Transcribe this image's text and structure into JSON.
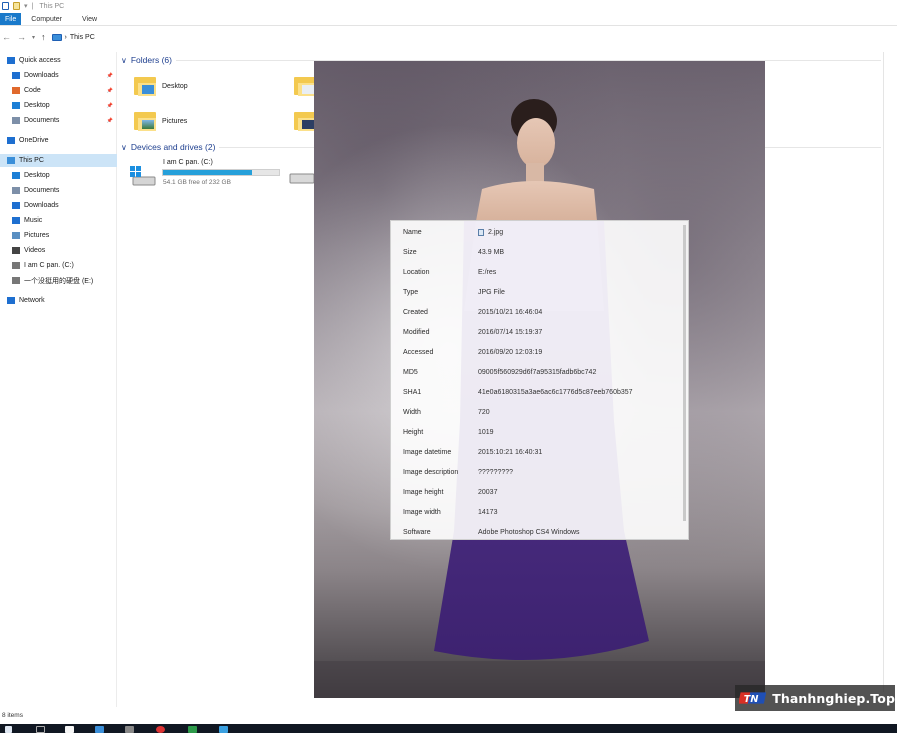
{
  "window": {
    "title": "This PC"
  },
  "ribbon": {
    "tabs": [
      "File",
      "Computer",
      "View"
    ]
  },
  "address": {
    "path": "This PC"
  },
  "sidebar": {
    "items": [
      {
        "label": "Quick access",
        "icon": "star-icon",
        "pinned": false,
        "indent": 0,
        "selected": false
      },
      {
        "label": "Downloads",
        "icon": "download-icon",
        "pinned": true,
        "indent": 1,
        "selected": false
      },
      {
        "label": "Code",
        "icon": "code-folder-icon",
        "pinned": true,
        "indent": 1,
        "selected": false
      },
      {
        "label": "Desktop",
        "icon": "desktop-icon",
        "pinned": true,
        "indent": 1,
        "selected": false
      },
      {
        "label": "Documents",
        "icon": "documents-icon",
        "pinned": true,
        "indent": 1,
        "selected": false
      },
      {
        "label": "OneDrive",
        "icon": "cloud-icon",
        "pinned": false,
        "indent": 0,
        "selected": false
      },
      {
        "label": "This PC",
        "icon": "pc-icon",
        "pinned": false,
        "indent": 0,
        "selected": true
      },
      {
        "label": "Desktop",
        "icon": "desktop-icon",
        "pinned": false,
        "indent": 1,
        "selected": false
      },
      {
        "label": "Documents",
        "icon": "documents-icon",
        "pinned": false,
        "indent": 1,
        "selected": false
      },
      {
        "label": "Downloads",
        "icon": "download-icon",
        "pinned": false,
        "indent": 1,
        "selected": false
      },
      {
        "label": "Music",
        "icon": "music-icon",
        "pinned": false,
        "indent": 1,
        "selected": false
      },
      {
        "label": "Pictures",
        "icon": "pictures-icon",
        "pinned": false,
        "indent": 1,
        "selected": false
      },
      {
        "label": "Videos",
        "icon": "videos-icon",
        "pinned": false,
        "indent": 1,
        "selected": false
      },
      {
        "label": "I am C pan. (C:)",
        "icon": "drive-icon",
        "pinned": false,
        "indent": 1,
        "selected": false
      },
      {
        "label": "一个没挺用的硬盘 (E:)",
        "icon": "drive-icon",
        "pinned": false,
        "indent": 1,
        "selected": false
      },
      {
        "label": "Network",
        "icon": "network-icon",
        "pinned": false,
        "indent": 0,
        "selected": false
      }
    ]
  },
  "main": {
    "folders_header": "Folders (6)",
    "folders": [
      {
        "name": "Desktop"
      },
      {
        "name": "Pictures"
      }
    ],
    "drives_header": "Devices and drives (2)",
    "drives": [
      {
        "name": "I am C pan. (C:)",
        "free_text": "54.1 GB free of 232 GB",
        "used_fraction": 0.77
      }
    ]
  },
  "metadata": {
    "rows": [
      {
        "key": "Name",
        "value": "2.jpg",
        "has_icon": true
      },
      {
        "key": "Size",
        "value": "43.9 MB"
      },
      {
        "key": "Location",
        "value": "E:/res"
      },
      {
        "key": "Type",
        "value": "JPG File"
      },
      {
        "key": "Created",
        "value": "2015/10/21 16:46:04"
      },
      {
        "key": "Modified",
        "value": "2016/07/14 15:19:37"
      },
      {
        "key": "Accessed",
        "value": "2016/09/20 12:03:19"
      },
      {
        "key": "MD5",
        "value": "09005f560929d6f7a95315fadb6bc742"
      },
      {
        "key": "SHA1",
        "value": "41e0a6180315a3ae6ac6c1776d5c87eeb760b357"
      },
      {
        "key": "Width",
        "value": "720"
      },
      {
        "key": "Height",
        "value": "1019"
      },
      {
        "key": "Image datetime",
        "value": "2015:10:21 16:40:31"
      },
      {
        "key": "Image description",
        "value": "?????????"
      },
      {
        "key": "Image height",
        "value": "20037"
      },
      {
        "key": "Image width",
        "value": "14173"
      },
      {
        "key": "Software",
        "value": "Adobe Photoshop CS4 Windows"
      }
    ]
  },
  "status": {
    "items_text": "8 items"
  },
  "watermark": {
    "text": "Thanhnghiep.Top",
    "logo_text": "TN"
  },
  "colors": {
    "accent": "#1979ca",
    "selection": "#cce4f7",
    "drive_fill": "#26a0da",
    "dress": "#4b2a84"
  }
}
